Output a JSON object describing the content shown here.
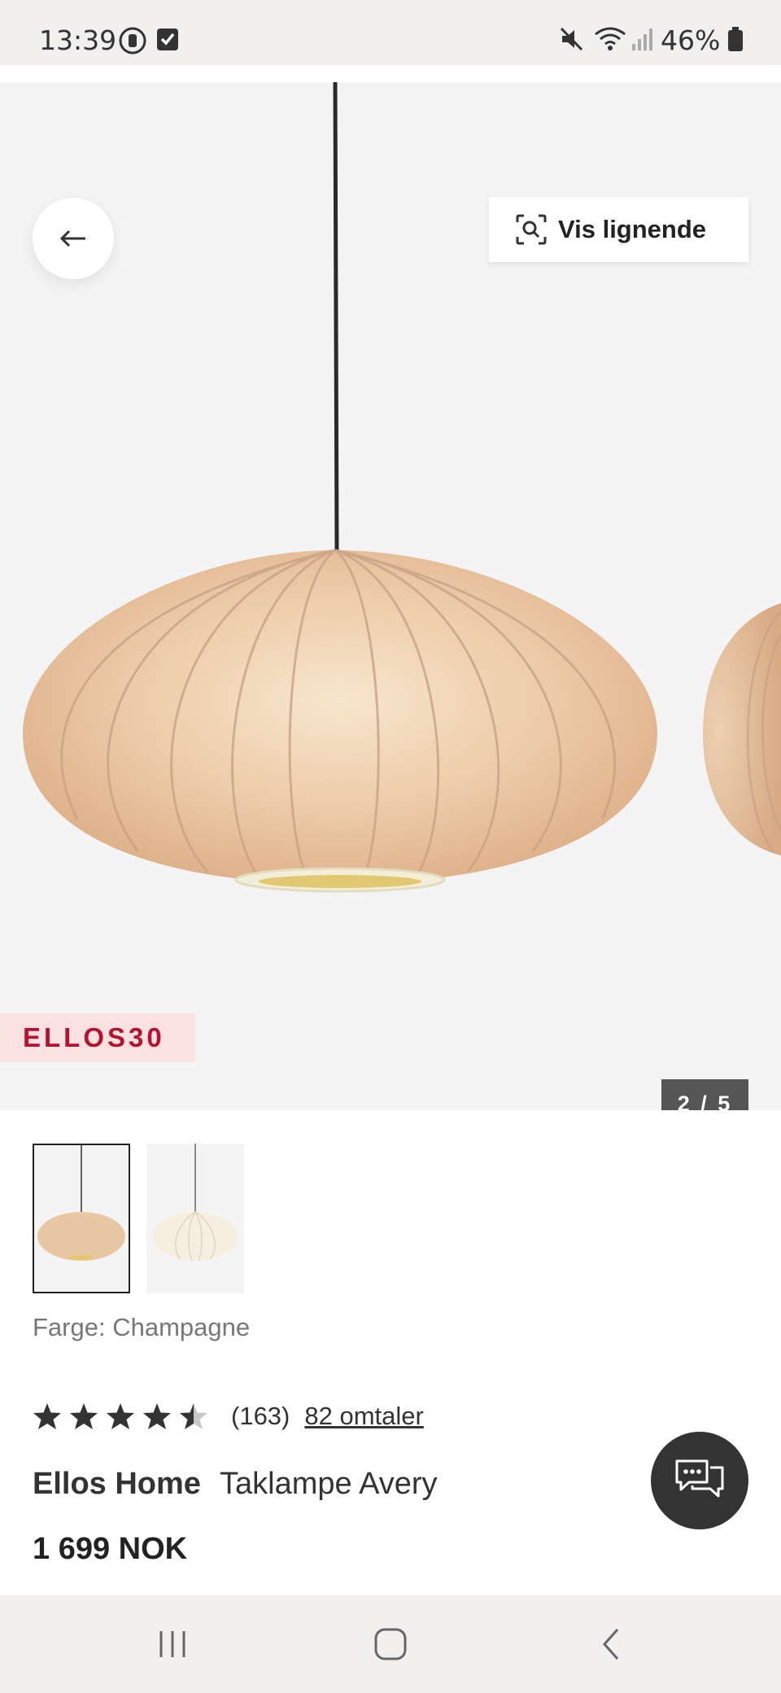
{
  "status_bar": {
    "time": "13:39",
    "battery": "46%",
    "icons": [
      "screen-record-icon",
      "check-box-icon",
      "mute-icon",
      "wifi-icon",
      "signal-icon",
      "battery-icon"
    ]
  },
  "hero": {
    "similar_label": "Vis lignende",
    "promo_code": "ELLOS30",
    "image_counter": "2 / 5"
  },
  "thumbnails": [
    "champagne",
    "white"
  ],
  "product": {
    "color_label": "Farge: Champagne",
    "rating_value": 4.5,
    "rating_count": "(163)",
    "reviews_link": "82 omtaler",
    "brand": "Ellos Home",
    "name": "Taklampe Avery",
    "price": "1 699 NOK"
  },
  "colors": {
    "promo_text": "#b5122f",
    "promo_bg": "#fbe2e1",
    "lamp": "#e9c7a5"
  }
}
